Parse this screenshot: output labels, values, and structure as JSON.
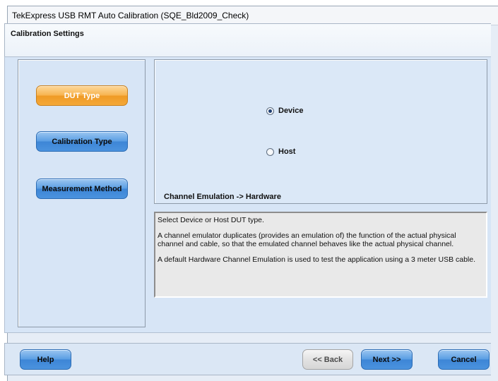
{
  "window": {
    "title": "TekExpress USB RMT Auto Calibration (SQE_Bld2009_Check)"
  },
  "header": {
    "title": "Calibration Settings"
  },
  "nav": {
    "items": [
      {
        "label": "DUT Type",
        "active": true
      },
      {
        "label": "Calibration Type",
        "active": false
      },
      {
        "label": "Measurement Method",
        "active": false
      }
    ]
  },
  "options": {
    "radios": [
      {
        "label": "Device",
        "checked": true
      },
      {
        "label": "Host",
        "checked": false
      }
    ],
    "emulation_label": "Channel Emulation -> Hardware"
  },
  "description": {
    "line1": "Select Device or Host DUT type.",
    "line2": "A channel emulator duplicates (provides an emulation of) the function of the actual physical channel and cable, so that the emulated channel behaves like the actual physical channel.",
    "line3": "A default Hardware Channel Emulation is used to test the application using a 3 meter USB cable."
  },
  "footer": {
    "help": "Help",
    "back": "<< Back",
    "next": "Next >>",
    "cancel": "Cancel"
  },
  "colors": {
    "active_nav": "#f4a838",
    "button_blue": "#4a92de",
    "panel_bg": "#d7e5f6"
  }
}
